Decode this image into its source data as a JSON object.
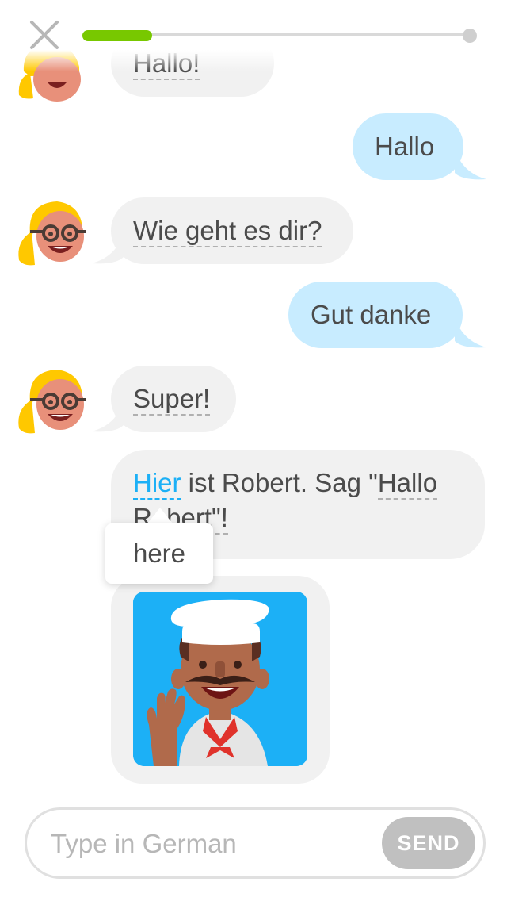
{
  "header": {
    "progress_percent": 18,
    "colors": {
      "progress_fill": "#78c800",
      "track": "#d9d9d9"
    }
  },
  "messages": [
    {
      "id": "m0",
      "from": "robot",
      "text": "Hallo!"
    },
    {
      "id": "m1",
      "from": "user",
      "text": "Hallo"
    },
    {
      "id": "m2",
      "from": "robot",
      "text": "Wie geht es dir?"
    },
    {
      "id": "m3",
      "from": "user",
      "text": "Gut danke"
    },
    {
      "id": "m4",
      "from": "robot",
      "text": "Super!"
    },
    {
      "id": "m5",
      "from": "robot",
      "parts": {
        "hint_word": "Hier",
        "rest_line1": " ist Robert. Sag \"",
        "hallo": "Hallo",
        "line2": "Robert\"!"
      }
    }
  ],
  "tooltip": {
    "text": "here"
  },
  "image_card": {
    "icon": "chef-waving-illustration"
  },
  "composer": {
    "placeholder": "Type in German",
    "send_label": "SEND"
  },
  "colors": {
    "bubble_in": "#f1f1f1",
    "bubble_out": "#c8ecff",
    "accent_blue": "#1cb0f6",
    "send_disabled": "#c0c0c0"
  }
}
